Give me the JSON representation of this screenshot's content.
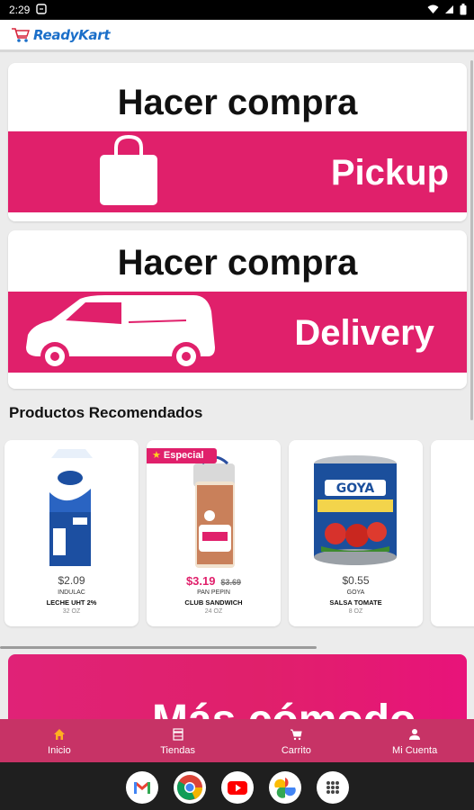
{
  "status_bar": {
    "time": "2:29"
  },
  "app": {
    "logo_text": "ReadyKart"
  },
  "cards": {
    "pickup": {
      "title": "Hacer compra",
      "label": "Pickup"
    },
    "delivery": {
      "title": "Hacer compra",
      "label": "Delivery"
    }
  },
  "section": {
    "title": "Productos Recomendados"
  },
  "products": [
    {
      "price": "$2.09",
      "brand": "INDULAC",
      "name": "LECHE UHT 2%",
      "size": "32 OZ"
    },
    {
      "badge": "Especial",
      "price": "$3.19",
      "old_price": "$3.69",
      "brand": "PAN PEPIN",
      "name": "CLUB SANDWICH",
      "size": "24 OZ"
    },
    {
      "price": "$0.55",
      "brand": "GOYA",
      "name": "SALSA TOMATE",
      "size": "8 OZ"
    }
  ],
  "promo": {
    "text": "Más cómodo"
  },
  "bottom_nav": [
    {
      "label": "Inicio",
      "icon": "home-icon",
      "active": true
    },
    {
      "label": "Tiendas",
      "icon": "store-icon"
    },
    {
      "label": "Carrito",
      "icon": "cart-icon"
    },
    {
      "label": "Mi Cuenta",
      "icon": "person-icon"
    }
  ],
  "dock_apps": [
    "gmail-icon",
    "chrome-icon",
    "youtube-icon",
    "photos-icon",
    "app-drawer-icon"
  ],
  "colors": {
    "brand_pink": "#e0206b",
    "nav_bg": "#c73366",
    "logo_blue": "#1b6fc9"
  }
}
